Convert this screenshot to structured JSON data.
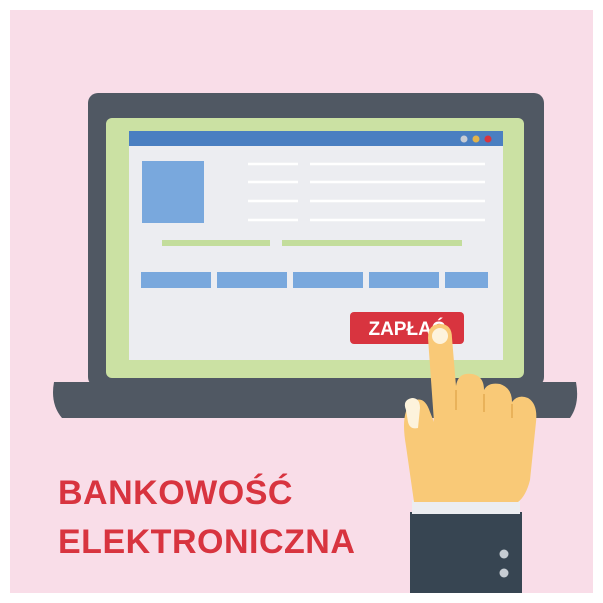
{
  "screen": {
    "pay_button_label": "ZAPŁAĆ"
  },
  "headline": {
    "line1": "BANKOWOŚĆ",
    "line2": "ELEKTRONICZNA"
  },
  "colors": {
    "background": "#f9dde8",
    "laptop_body": "#505863",
    "screen_bezel": "#cbe1a3",
    "screen_content": "#ecedf1",
    "accent_blue": "#4a7fc1",
    "block_blue": "#79a8dd",
    "green_line": "#c3dd9c",
    "pay_button": "#d8343f",
    "headline_red": "#d8343f",
    "skin": "#f9c977",
    "sleeve": "#374552"
  },
  "icons": {
    "window_dots": "window-controls-icon",
    "hand": "pointing-hand-icon"
  }
}
